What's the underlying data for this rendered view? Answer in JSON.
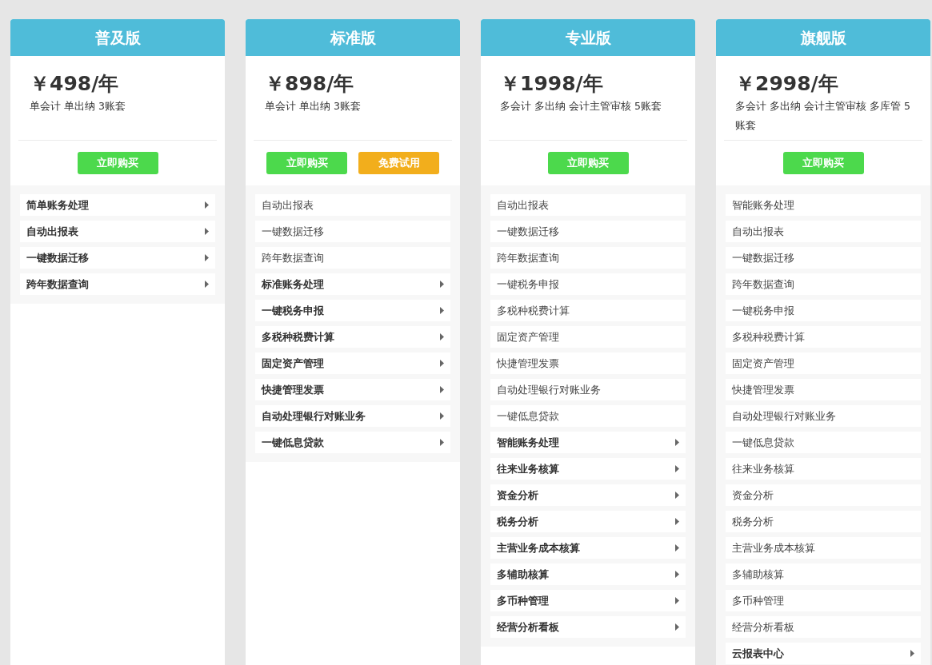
{
  "plans": [
    {
      "title": "普及版",
      "price": "￥498/年",
      "desc": "单会计 单出纳 3账套",
      "buttons": [
        {
          "kind": "buy",
          "label": "立即购买"
        }
      ],
      "features": [
        {
          "kind": "detail",
          "label": "简单账务处理"
        },
        {
          "kind": "detail",
          "label": "自动出报表"
        },
        {
          "kind": "detail",
          "label": "一键数据迁移"
        },
        {
          "kind": "detail",
          "label": "跨年数据查询"
        }
      ]
    },
    {
      "title": "标准版",
      "price": "￥898/年",
      "desc": "单会计 单出纳 3账套",
      "buttons": [
        {
          "kind": "buy",
          "label": "立即购买"
        },
        {
          "kind": "trial",
          "label": "免费试用"
        }
      ],
      "features": [
        {
          "kind": "plain",
          "label": "自动出报表"
        },
        {
          "kind": "plain",
          "label": "一键数据迁移"
        },
        {
          "kind": "plain",
          "label": "跨年数据查询"
        },
        {
          "kind": "detail",
          "label": "标准账务处理"
        },
        {
          "kind": "detail",
          "label": "一键税务申报"
        },
        {
          "kind": "detail",
          "label": "多税种税费计算"
        },
        {
          "kind": "detail",
          "label": "固定资产管理"
        },
        {
          "kind": "detail",
          "label": "快捷管理发票"
        },
        {
          "kind": "detail",
          "label": "自动处理银行对账业务"
        },
        {
          "kind": "detail",
          "label": "一键低息贷款"
        }
      ]
    },
    {
      "title": "专业版",
      "price": "￥1998/年",
      "desc": "多会计 多出纳 会计主管审核 5账套",
      "buttons": [
        {
          "kind": "buy",
          "label": "立即购买"
        }
      ],
      "features": [
        {
          "kind": "plain",
          "label": "自动出报表"
        },
        {
          "kind": "plain",
          "label": "一键数据迁移"
        },
        {
          "kind": "plain",
          "label": "跨年数据查询"
        },
        {
          "kind": "plain",
          "label": "一键税务申报"
        },
        {
          "kind": "plain",
          "label": "多税种税费计算"
        },
        {
          "kind": "plain",
          "label": "固定资产管理"
        },
        {
          "kind": "plain",
          "label": "快捷管理发票"
        },
        {
          "kind": "plain",
          "label": "自动处理银行对账业务"
        },
        {
          "kind": "plain",
          "label": "一键低息贷款"
        },
        {
          "kind": "detail",
          "label": "智能账务处理"
        },
        {
          "kind": "detail",
          "label": "往来业务核算"
        },
        {
          "kind": "detail",
          "label": "资金分析"
        },
        {
          "kind": "detail",
          "label": "税务分析"
        },
        {
          "kind": "detail",
          "label": "主营业务成本核算"
        },
        {
          "kind": "detail",
          "label": "多辅助核算"
        },
        {
          "kind": "detail",
          "label": "多币种管理"
        },
        {
          "kind": "detail",
          "label": "经营分析看板"
        }
      ]
    },
    {
      "title": "旗舰版",
      "price": "￥2998/年",
      "desc": "多会计 多出纳 会计主管审核 多库管 5账套",
      "buttons": [
        {
          "kind": "buy",
          "label": "立即购买"
        }
      ],
      "features": [
        {
          "kind": "plain",
          "label": "智能账务处理"
        },
        {
          "kind": "plain",
          "label": "自动出报表"
        },
        {
          "kind": "plain",
          "label": "一键数据迁移"
        },
        {
          "kind": "plain",
          "label": "跨年数据查询"
        },
        {
          "kind": "plain",
          "label": "一键税务申报"
        },
        {
          "kind": "plain",
          "label": "多税种税费计算"
        },
        {
          "kind": "plain",
          "label": "固定资产管理"
        },
        {
          "kind": "plain",
          "label": "快捷管理发票"
        },
        {
          "kind": "plain",
          "label": "自动处理银行对账业务"
        },
        {
          "kind": "plain",
          "label": "一键低息贷款"
        },
        {
          "kind": "plain",
          "label": "往来业务核算"
        },
        {
          "kind": "plain",
          "label": "资金分析"
        },
        {
          "kind": "plain",
          "label": "税务分析"
        },
        {
          "kind": "plain",
          "label": "主营业务成本核算"
        },
        {
          "kind": "plain",
          "label": "多辅助核算"
        },
        {
          "kind": "plain",
          "label": "多币种管理"
        },
        {
          "kind": "plain",
          "label": "经营分析看板"
        },
        {
          "kind": "detail",
          "label": "云报表中心"
        }
      ]
    }
  ]
}
